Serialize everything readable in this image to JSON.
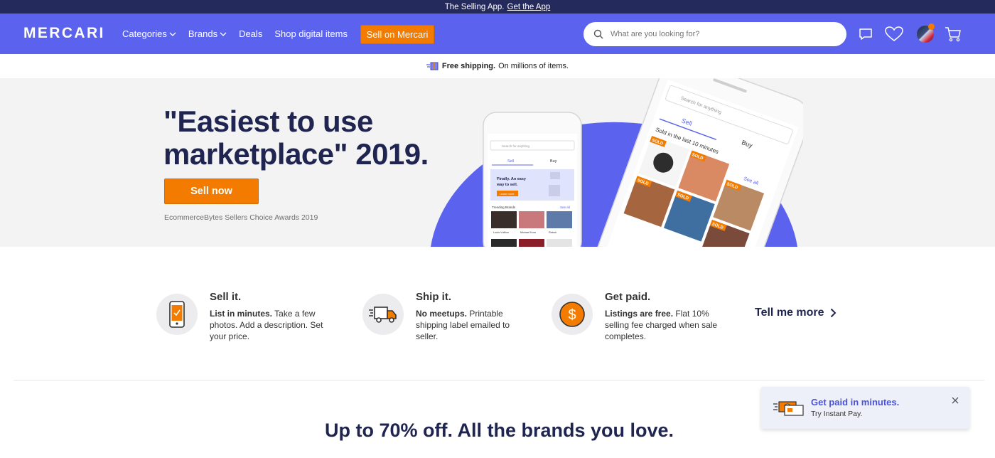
{
  "top_strip": {
    "text": "The Selling App.",
    "link": "Get the App"
  },
  "header": {
    "logo": "MERCARI",
    "nav": [
      {
        "label": "Categories",
        "dropdown": true
      },
      {
        "label": "Brands",
        "dropdown": true
      },
      {
        "label": "Deals",
        "dropdown": false
      },
      {
        "label": "Shop digital items",
        "dropdown": false
      }
    ],
    "sell_button": "Sell on Mercari",
    "search_placeholder": "What are you looking for?",
    "icons": [
      "search-icon",
      "chat-icon",
      "heart-icon",
      "avatar",
      "cart-icon"
    ],
    "accent_color": "#5b63ee"
  },
  "shipping_bar": {
    "bold": "Free shipping.",
    "text": "On millions of items."
  },
  "hero": {
    "title_line1": "\"Easiest to use",
    "title_line2": "marketplace\" 2019.",
    "button": "Sell now",
    "caption": "EcommerceBytes Sellers Choice Awards 2019",
    "phone_small": {
      "search": "Search for anything",
      "tab_sell": "Sell",
      "tab_buy": "Buy",
      "promo_line1": "Finally. An easy",
      "promo_line2": "way to sell.",
      "promo_btn": "Learn more",
      "trending": "Trending Brands",
      "see_all": "See all",
      "brands": [
        "Louis Vuitton",
        "Michael Kors",
        "Rebok"
      ]
    },
    "phone_large": {
      "search": "Search for anything",
      "tab_sell": "Sell",
      "tab_buy": "Buy",
      "sold_heading": "Sold in the last 10 minutes",
      "see_all": "See all",
      "badge": "SOLD"
    }
  },
  "features": [
    {
      "title": "Sell it.",
      "bold": "List in minutes.",
      "text": "Take a few photos. Add a description. Set your price.",
      "icon": "phone-check-icon"
    },
    {
      "title": "Ship it.",
      "bold": "No meetups.",
      "text": "Printable shipping label emailed to seller.",
      "icon": "truck-icon"
    },
    {
      "title": "Get paid.",
      "bold": "Listings are free.",
      "text": "Flat 10% selling fee charged when sale completes.",
      "icon": "dollar-icon"
    }
  ],
  "tell_more": "Tell me more",
  "bottom_title": "Up to 70% off. All the brands you love.",
  "toast": {
    "title": "Get paid in minutes.",
    "subtitle": "Try Instant Pay."
  }
}
